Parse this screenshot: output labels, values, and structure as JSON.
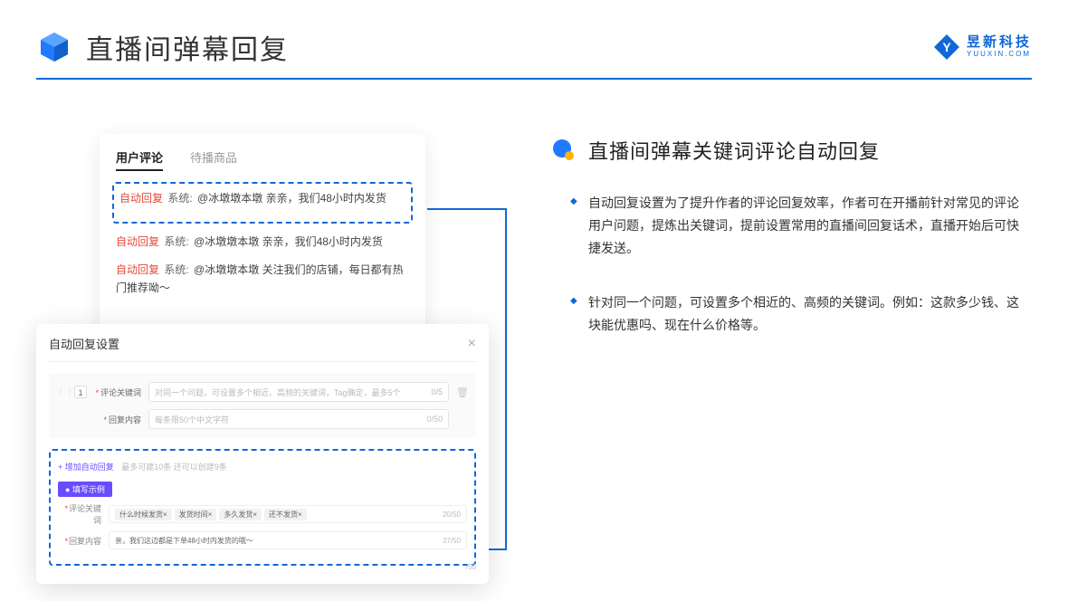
{
  "header": {
    "title": "直播间弹幕回复",
    "brand_name": "昱新科技",
    "brand_url": "YUUXIN.COM"
  },
  "comment_panel": {
    "tab_active": "用户评论",
    "tab_other": "待播商品",
    "line1_tag": "自动回复",
    "line1_sys": "系统:",
    "line1_text": "@冰墩墩本墩 亲亲，我们48小时内发货",
    "line2_tag": "自动回复",
    "line2_sys": "系统:",
    "line2_text": "@冰墩墩本墩 亲亲，我们48小时内发货",
    "line3_tag": "自动回复",
    "line3_sys": "系统:",
    "line3_text": "@冰墩墩本墩 关注我们的店铺，每日都有热门推荐呦～"
  },
  "modal": {
    "title": "自动回复设置",
    "row_num": "1",
    "label_keyword": "评论关键词",
    "placeholder_keyword": "对同一个问题，可设置多个相近、高频的关键词，Tag确定，最多5个",
    "counter_keyword": "0/5",
    "label_content": "回复内容",
    "placeholder_content": "每条限50个中文字符",
    "counter_content": "0/50",
    "add_link": "+ 增加自动回复",
    "add_hint": "最多可建10条 还可以创建9条",
    "example_badge": "● 填写示例",
    "ex_label_keyword": "评论关键词",
    "ex_tag1": "什么时候发货×",
    "ex_tag2": "发货时间×",
    "ex_tag3": "多久发货×",
    "ex_tag4": "还不发货×",
    "ex_counter1": "20/50",
    "ex_label_content": "回复内容",
    "ex_content_text": "亲，我们这边都是下单48小时内发货的哦～",
    "ex_counter2": "37/50",
    "bottom_counter": "/50"
  },
  "right": {
    "section_title": "直播间弹幕关键词评论自动回复",
    "bullet1": "自动回复设置为了提升作者的评论回复效率，作者可在开播前针对常见的评论用户问题，提炼出关键词，提前设置常用的直播间回复话术，直播开始后可快捷发送。",
    "bullet2": "针对同一个问题，可设置多个相近的、高频的关键词。例如：这款多少钱、这块能优惠吗、现在什么价格等。"
  }
}
